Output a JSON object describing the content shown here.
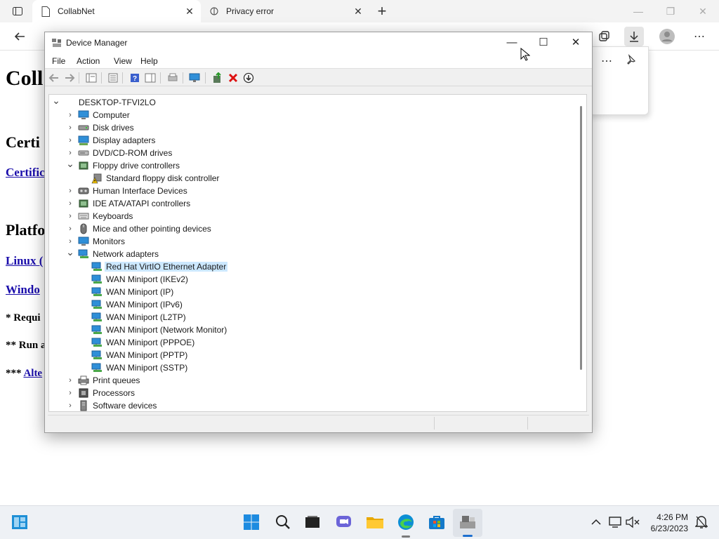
{
  "browser": {
    "tabs": [
      {
        "title": "CollabNet",
        "active": true
      },
      {
        "title": "Privacy error",
        "active": false
      }
    ],
    "page": {
      "heading_visible": "Coll",
      "section1_visible": "Certi",
      "link1_visible": "Certific",
      "section2_visible": "Platfo",
      "link2_visible": "Linux (",
      "link3_visible": "Windo",
      "note1_visible": "* Requi",
      "note2_visible": "** Run a",
      "note3_prefix": "***",
      "note3_link_visible": "Alte"
    }
  },
  "device_manager": {
    "title": "Device Manager",
    "menu": [
      "File",
      "Action",
      "View",
      "Help"
    ],
    "tree": {
      "root": "DESKTOP-TFVI2LO",
      "categories": [
        {
          "label": "Computer",
          "icon": "computer-icon",
          "expanded": false
        },
        {
          "label": "Disk drives",
          "icon": "disk-icon",
          "expanded": false
        },
        {
          "label": "Display adapters",
          "icon": "display-icon",
          "expanded": false
        },
        {
          "label": "DVD/CD-ROM drives",
          "icon": "dvd-icon",
          "expanded": false
        },
        {
          "label": "Floppy drive controllers",
          "icon": "controller-icon",
          "expanded": true,
          "children": [
            {
              "label": "Standard floppy disk controller",
              "icon": "warning-device-icon",
              "selected": false
            }
          ]
        },
        {
          "label": "Human Interface Devices",
          "icon": "hid-icon",
          "expanded": false
        },
        {
          "label": "IDE ATA/ATAPI controllers",
          "icon": "controller-icon",
          "expanded": false
        },
        {
          "label": "Keyboards",
          "icon": "keyboard-icon",
          "expanded": false
        },
        {
          "label": "Mice and other pointing devices",
          "icon": "mouse-icon",
          "expanded": false
        },
        {
          "label": "Monitors",
          "icon": "monitor-icon",
          "expanded": false
        },
        {
          "label": "Network adapters",
          "icon": "network-icon",
          "expanded": true,
          "children": [
            {
              "label": "Red Hat VirtIO Ethernet Adapter",
              "icon": "network-icon",
              "selected": true
            },
            {
              "label": "WAN Miniport (IKEv2)",
              "icon": "network-icon",
              "selected": false
            },
            {
              "label": "WAN Miniport (IP)",
              "icon": "network-icon",
              "selected": false
            },
            {
              "label": "WAN Miniport (IPv6)",
              "icon": "network-icon",
              "selected": false
            },
            {
              "label": "WAN Miniport (L2TP)",
              "icon": "network-icon",
              "selected": false
            },
            {
              "label": "WAN Miniport (Network Monitor)",
              "icon": "network-icon",
              "selected": false
            },
            {
              "label": "WAN Miniport (PPPOE)",
              "icon": "network-icon",
              "selected": false
            },
            {
              "label": "WAN Miniport (PPTP)",
              "icon": "network-icon",
              "selected": false
            },
            {
              "label": "WAN Miniport (SSTP)",
              "icon": "network-icon",
              "selected": false
            }
          ]
        },
        {
          "label": "Print queues",
          "icon": "printer-icon",
          "expanded": false
        },
        {
          "label": "Processors",
          "icon": "processor-icon",
          "expanded": false
        },
        {
          "label": "Software devices",
          "icon": "software-icon",
          "expanded": false
        }
      ]
    }
  },
  "taskbar": {
    "time": "4:26 PM",
    "date": "6/23/2023"
  },
  "colors": {
    "selection": "#cce8ff",
    "link": "#1a0dab",
    "network_icon": "#2f8fd8"
  }
}
